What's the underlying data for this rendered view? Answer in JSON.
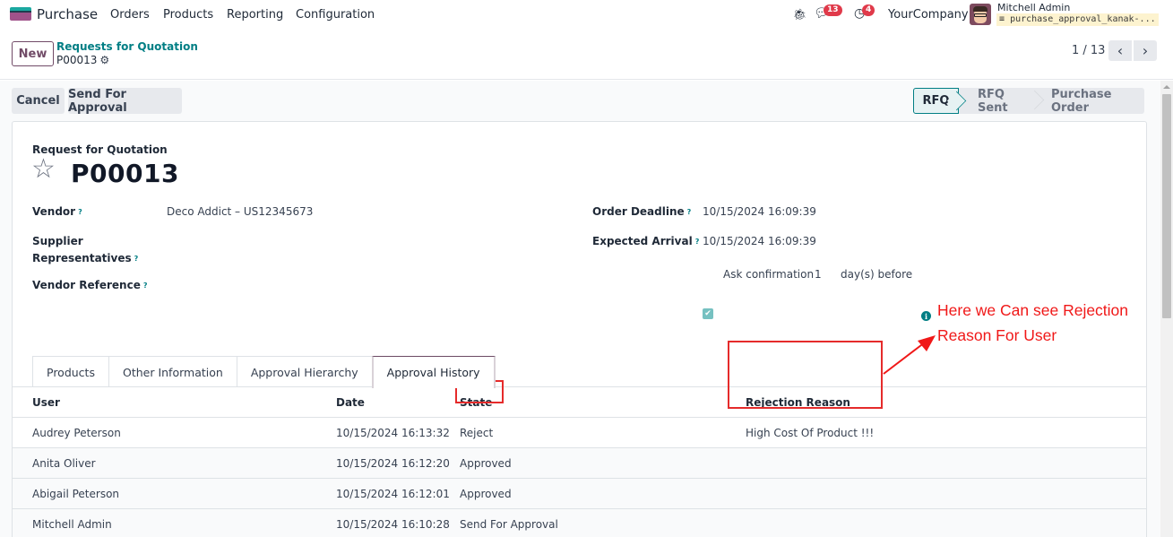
{
  "topbar": {
    "app_name": "Purchase",
    "menu": [
      "Orders",
      "Products",
      "Reporting",
      "Configuration"
    ],
    "icons": {
      "debug": "bug-icon",
      "messages": "chat-icon",
      "activities": "clock-icon"
    },
    "messages_count": "13",
    "activities_count": "4",
    "company": "YourCompany",
    "user_name": "Mitchell Admin",
    "database": "purchase_approval_kanak-..."
  },
  "control_panel": {
    "new_label": "New",
    "breadcrumb_parent": "Requests for Quotation",
    "record_name": "P00013",
    "pager": "1 / 13"
  },
  "actions": {
    "cancel_label": "Cancel",
    "send_label": "Send For Approval"
  },
  "statusbar": {
    "stages": [
      "RFQ",
      "RFQ Sent",
      "Purchase Order"
    ],
    "current": "RFQ"
  },
  "form": {
    "subtitle": "Request for Quotation",
    "title": "P00013",
    "fields": {
      "vendor_label": "Vendor",
      "vendor_value": "Deco Addict – US12345673",
      "supplier_rep_label_1": "Supplier",
      "supplier_rep_label_2": "Representatives",
      "vendor_ref_label": "Vendor Reference",
      "order_deadline_label": "Order Deadline",
      "order_deadline_value": "10/15/2024 16:09:39",
      "expected_arrival_label": "Expected Arrival",
      "expected_arrival_value": "10/15/2024 16:09:39",
      "ask_confirmation_label": "Ask confirmation",
      "ask_confirmation_days": "1",
      "ask_confirmation_suffix": "day(s) before",
      "ask_confirmation_checked": true
    },
    "help_mark": "?"
  },
  "tabs": [
    {
      "label": "Products",
      "active": false
    },
    {
      "label": "Other Information",
      "active": false
    },
    {
      "label": "Approval Hierarchy",
      "active": false
    },
    {
      "label": "Approval History",
      "active": true
    }
  ],
  "history_table": {
    "columns": [
      "User",
      "Date",
      "State",
      "Rejection Reason"
    ],
    "rows": [
      {
        "user": "Audrey Peterson",
        "date": "10/15/2024 16:13:32",
        "state": "Reject",
        "reason": "High Cost Of Product !!!"
      },
      {
        "user": "Anita Oliver",
        "date": "10/15/2024 16:12:20",
        "state": "Approved",
        "reason": ""
      },
      {
        "user": "Abigail Peterson",
        "date": "10/15/2024 16:12:01",
        "state": "Approved",
        "reason": ""
      },
      {
        "user": "Mitchell Admin",
        "date": "10/15/2024 16:10:28",
        "state": "Send For Approval",
        "reason": ""
      }
    ]
  },
  "annotation": {
    "line1": "Here we Can see Rejection",
    "line2": "Reason For User",
    "color": "#f01818"
  },
  "colors": {
    "brand": "#714b67",
    "accent": "#017e84",
    "badge": "#e03a4a"
  }
}
